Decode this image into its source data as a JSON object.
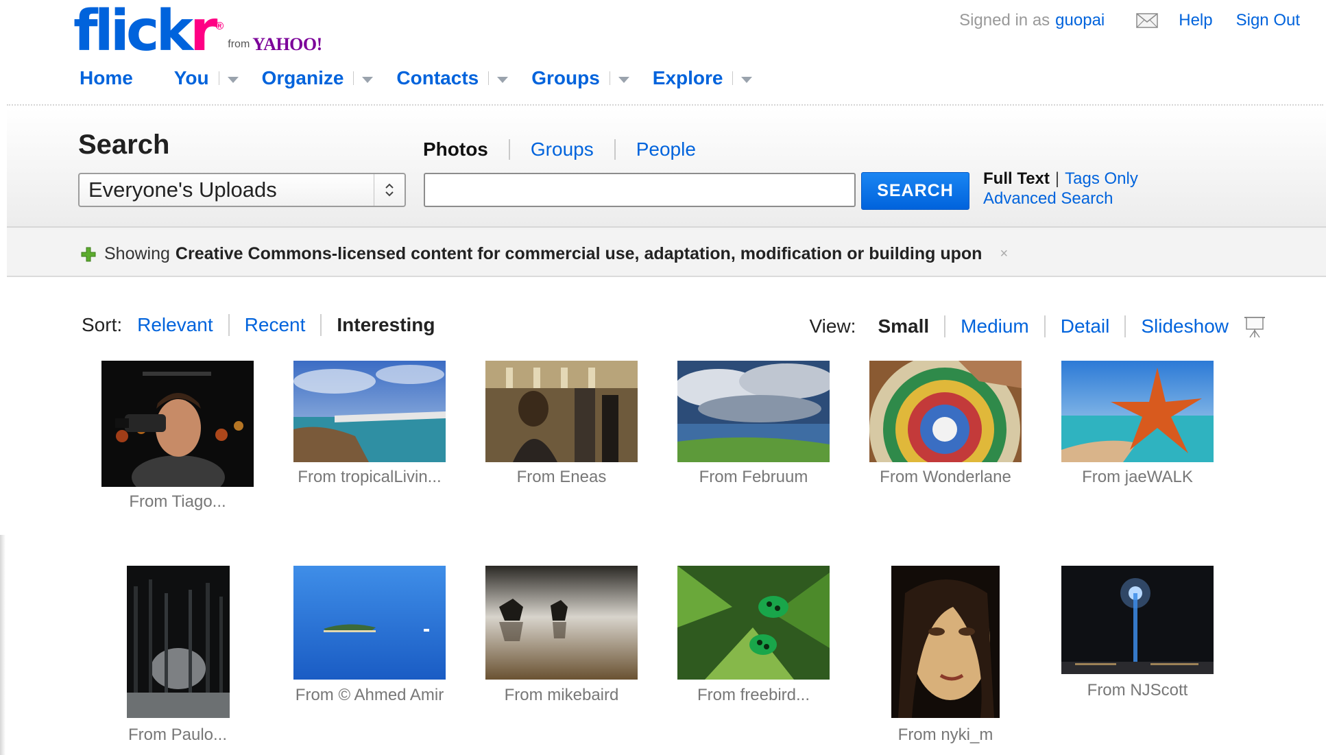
{
  "brand": {
    "logo_fl": "flick",
    "logo_r": "r",
    "logo_reg": "®",
    "from": "from",
    "yahoo": "YAHOO!"
  },
  "nav": {
    "home": "Home",
    "items": [
      "You",
      "Organize",
      "Contacts",
      "Groups",
      "Explore"
    ]
  },
  "usernav": {
    "signed_in": "Signed in as",
    "user": "guopai",
    "help": "Help",
    "sign_out": "Sign Out"
  },
  "search": {
    "title": "Search",
    "tabs": {
      "photos": "Photos",
      "groups": "Groups",
      "people": "People"
    },
    "scope": "Everyone's Uploads",
    "query": "",
    "button": "SEARCH",
    "full_text": "Full Text",
    "separator": "|",
    "tags_only": "Tags Only",
    "advanced": "Advanced Search"
  },
  "notice": {
    "showing": "Showing",
    "text": "Creative Commons-licensed content for commercial use, adaptation, modification or building upon",
    "close": "×"
  },
  "sort": {
    "label": "Sort:",
    "relevant": "Relevant",
    "recent": "Recent",
    "interesting": "Interesting"
  },
  "view": {
    "label": "View:",
    "small": "Small",
    "medium": "Medium",
    "detail": "Detail",
    "slideshow": "Slideshow"
  },
  "photos": [
    {
      "caption": "From Tiago..."
    },
    {
      "caption": "From tropicalLivin..."
    },
    {
      "caption": "From Eneas"
    },
    {
      "caption": "From Februum"
    },
    {
      "caption": "From Wonderlane"
    },
    {
      "caption": "From jaeWALK"
    },
    {
      "caption": "From Paulo..."
    },
    {
      "caption": "From © Ahmed Amir"
    },
    {
      "caption": "From mikebaird"
    },
    {
      "caption": "From freebird..."
    },
    {
      "caption": "From nyki_m"
    },
    {
      "caption": "From NJScott"
    }
  ],
  "colors": {
    "link": "#0063dc",
    "brand_pink": "#ff0084",
    "yahoo_purple": "#7b0099",
    "button": "#0063dc"
  }
}
